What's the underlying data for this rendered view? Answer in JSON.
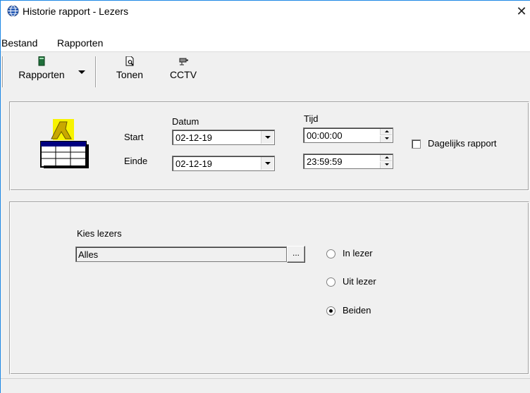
{
  "window": {
    "title": "Historie rapport - Lezers",
    "close_glyph": "✕"
  },
  "menu": {
    "items": [
      "Bestand",
      "Rapporten"
    ]
  },
  "toolbar": {
    "rapporten_label": "Rapporten",
    "tonen_label": "Tonen",
    "cctv_label": "CCTV"
  },
  "period": {
    "datum_header": "Datum",
    "tijd_header": "Tijd",
    "start_label": "Start",
    "einde_label": "Einde",
    "start_date": "02-12-19",
    "end_date": "02-12-19",
    "start_time": "00:00:00",
    "end_time": "23:59:59",
    "daily_report_label": "Dagelijks rapport",
    "daily_report_checked": false
  },
  "readers": {
    "choose_label": "Kies lezers",
    "selection_value": "Alles",
    "browse_label": "...",
    "options": [
      "In lezer",
      "Uit lezer",
      "Beiden"
    ],
    "selected": "Beiden"
  },
  "colors": {
    "window_border": "#1e88e5",
    "face": "#f0f0f0"
  }
}
